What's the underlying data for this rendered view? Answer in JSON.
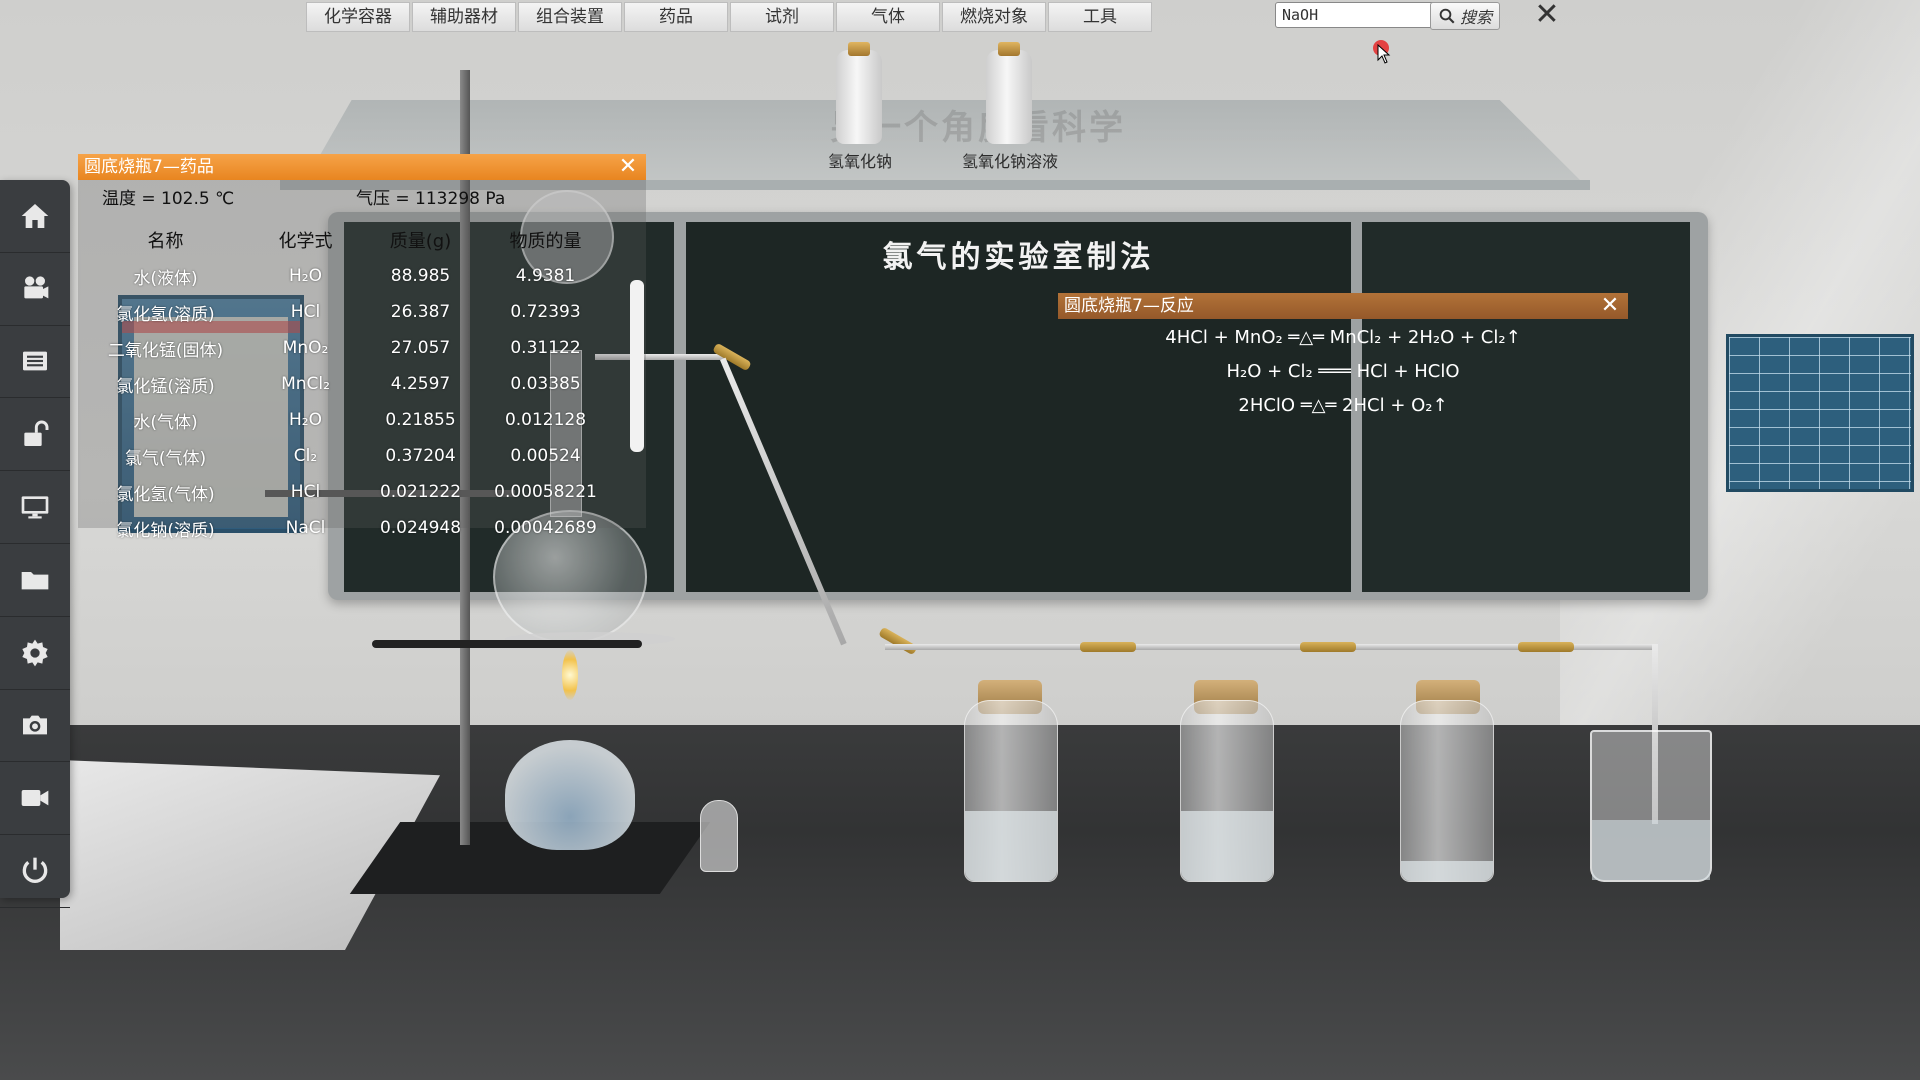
{
  "top_menu": [
    "化学容器",
    "辅助器材",
    "组合装置",
    "药品",
    "试剂",
    "气体",
    "燃烧对象",
    "工具"
  ],
  "search": {
    "value": "NaOH",
    "button_label": "搜索"
  },
  "reagents": [
    {
      "label": "氢氧化钠"
    },
    {
      "label": "氢氧化钠溶液"
    }
  ],
  "board_title": "氯气的实验室制法",
  "shelf_watermark": "另一个角度看科学",
  "drug_panel": {
    "title": "圆底烧瓶7—药品",
    "temperature": "温度 = 102.5 ℃",
    "pressure": "气压 = 113298 Pa",
    "headers": [
      "名称",
      "化学式",
      "质量(g)",
      "物质的量"
    ],
    "rows": [
      [
        "水(液体)",
        "H₂O",
        "88.985",
        "4.9381"
      ],
      [
        "氯化氢(溶质)",
        "HCl",
        "26.387",
        "0.72393"
      ],
      [
        "二氧化锰(固体)",
        "MnO₂",
        "27.057",
        "0.31122"
      ],
      [
        "氯化锰(溶质)",
        "MnCl₂",
        "4.2597",
        "0.03385"
      ],
      [
        "水(气体)",
        "H₂O",
        "0.21855",
        "0.012128"
      ],
      [
        "氯气(气体)",
        "Cl₂",
        "0.37204",
        "0.00524"
      ],
      [
        "氯化氢(气体)",
        "HCl",
        "0.021222",
        "0.00058221"
      ],
      [
        "氯化钠(溶质)",
        "NaCl",
        "0.024948",
        "0.00042689"
      ]
    ]
  },
  "reaction_panel": {
    "title": "圆底烧瓶7—反应",
    "equations": [
      "4HCl + MnO₂ ═△═ MnCl₂ + 2H₂O + Cl₂↑",
      "H₂O + Cl₂ ═══ HCl + HClO",
      "2HClO ═△═ 2HCl + O₂↑"
    ]
  },
  "sidebar": [
    "home-icon",
    "camera-reel-icon",
    "list-icon",
    "unlock-icon",
    "monitor-icon",
    "folder-icon",
    "settings-icon",
    "photo-camera-icon",
    "video-icon",
    "power-icon"
  ],
  "colors": {
    "drug_header": "#e88520",
    "reaction_header": "#95592a",
    "sidebar": "#3a3d40",
    "board": "#1d2624"
  }
}
